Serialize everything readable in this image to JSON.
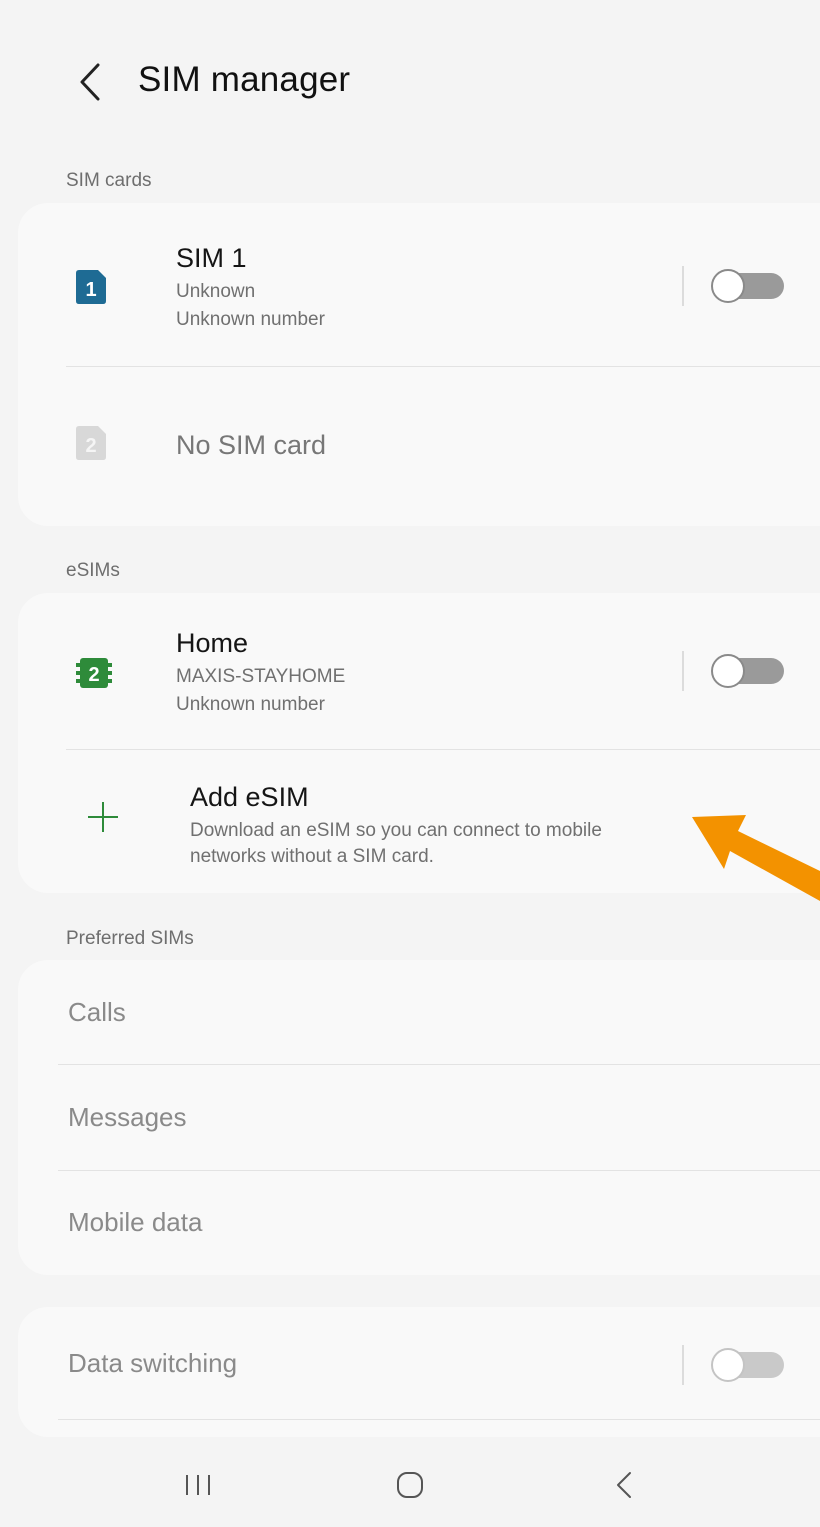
{
  "header": {
    "title": "SIM manager"
  },
  "sim_cards": {
    "section_label": "SIM cards",
    "sim1": {
      "badge": "1",
      "title": "SIM 1",
      "line1": "Unknown",
      "line2": "Unknown number",
      "enabled": false
    },
    "sim2": {
      "badge": "2",
      "title": "No SIM card"
    }
  },
  "esims": {
    "section_label": "eSIMs",
    "home": {
      "badge": "2",
      "title": "Home",
      "line1": "MAXIS-STAYHOME",
      "line2": "Unknown number",
      "enabled": false
    },
    "add": {
      "title": "Add eSIM",
      "line1": "Download an eSIM so you can connect to mobile",
      "line2": "networks without a SIM card."
    }
  },
  "preferred": {
    "section_label": "Preferred SIMs",
    "items": [
      "Calls",
      "Messages",
      "Mobile data"
    ]
  },
  "data_switching": {
    "label": "Data switching",
    "enabled": false
  },
  "colors": {
    "sim1_blue": "#1e6b94",
    "esim_green": "#2e8b3a",
    "annotation_arrow": "#f39200"
  },
  "navbar": {
    "icons": [
      "recent-apps-icon",
      "home-icon",
      "back-icon"
    ]
  }
}
